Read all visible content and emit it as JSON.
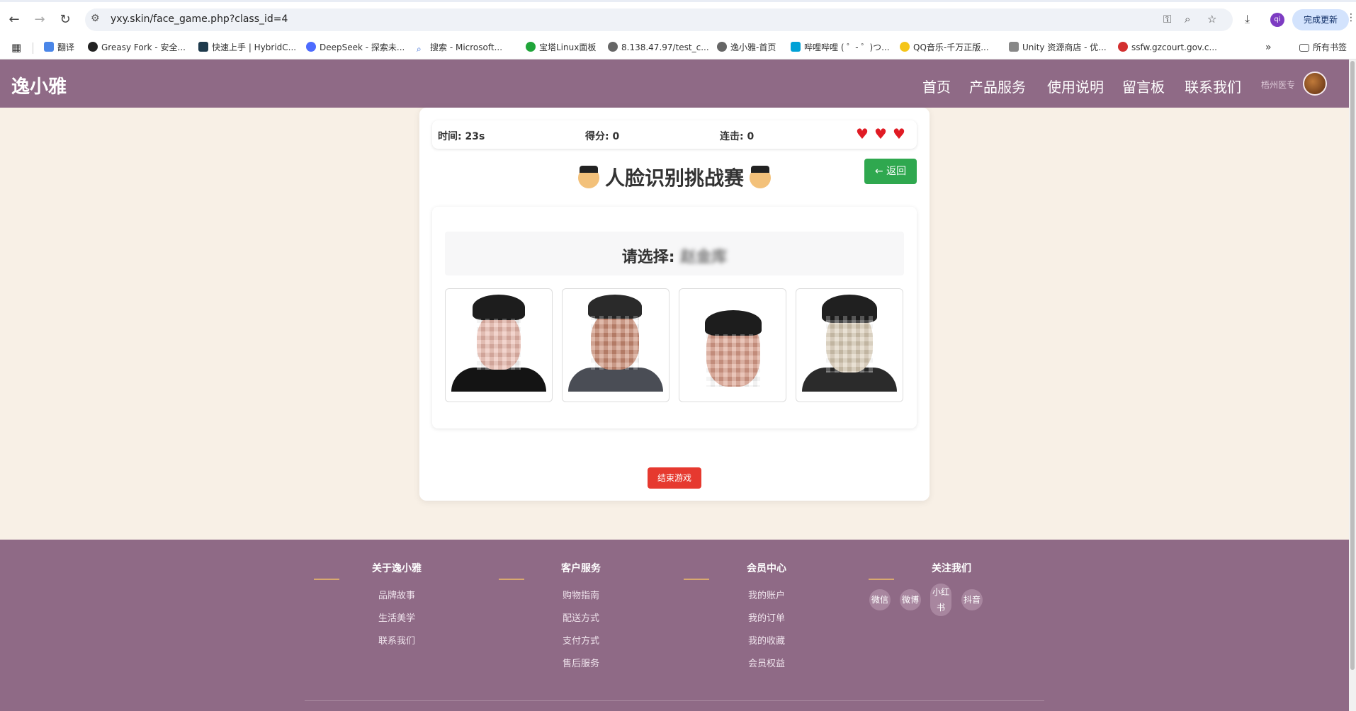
{
  "browser": {
    "url": "yxy.skin/face_game.php?class_id=4",
    "update_label": "完成更新",
    "profile_initial": "qi",
    "bookmarks": [
      "翻译",
      "Greasy Fork - 安全...",
      "快速上手 | HybridC...",
      "DeepSeek - 探索未...",
      "搜索 - Microsoft...",
      "宝塔Linux面板",
      "8.138.47.97/test_c...",
      "逸小雅-首页",
      "哔哩哔哩 ( ゜- ゜)つ...",
      "QQ音乐-千万正版...",
      "Unity 资源商店 - 优...",
      "ssfw.gzcourt.gov.c..."
    ],
    "all_bookmarks": "所有书签"
  },
  "header": {
    "logo": "逸小雅",
    "nav": [
      "首页",
      "产品服务",
      "使用说明",
      "留言板",
      "联系我们"
    ],
    "user_name": "梧州医专"
  },
  "game": {
    "time": "时间: 23s",
    "score": "得分: 0",
    "combo": "连击: 0",
    "lives": 3,
    "title": "人脸识别挑战赛",
    "back_label": "← 返回",
    "prompt_label": "请选择: ",
    "prompt_name": "赵金库",
    "end_label": "结束游戏"
  },
  "footer": {
    "columns": [
      {
        "title": "关于逸小雅",
        "links": [
          "品牌故事",
          "生活美学",
          "联系我们"
        ]
      },
      {
        "title": "客户服务",
        "links": [
          "购物指南",
          "配送方式",
          "支付方式",
          "售后服务"
        ]
      },
      {
        "title": "会员中心",
        "links": [
          "我的账户",
          "我的订单",
          "我的收藏",
          "会员权益"
        ]
      },
      {
        "title": "关注我们",
        "links": []
      }
    ],
    "social": [
      "微信",
      "微博",
      "小红书",
      "抖音"
    ]
  },
  "colors": {
    "brand": "#8f6a86",
    "page_bg": "#f8f0e6",
    "back_button": "#2fa84f",
    "end_button": "#e6392f",
    "heart": "#e01b24"
  }
}
